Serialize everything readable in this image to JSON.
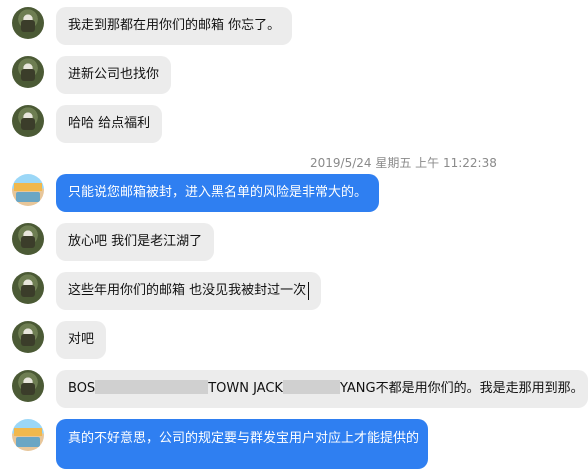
{
  "messages": [
    {
      "id": "m1",
      "sender": "user",
      "text": "我走到那都在用你们的邮箱  你忘了。"
    },
    {
      "id": "m2",
      "sender": "user",
      "text": "进新公司也找你"
    },
    {
      "id": "m3",
      "sender": "user",
      "text": "哈哈  给点福利"
    },
    {
      "id": "m4",
      "sender": "service",
      "text": "只能说您邮箱被封，进入黑名单的风险是非常大的。"
    },
    {
      "id": "m5",
      "sender": "user",
      "text": "放心吧  我们是老江湖了"
    },
    {
      "id": "m6",
      "sender": "user",
      "text": "这些年用你们的邮箱 也没见我被封过一次"
    },
    {
      "id": "m7",
      "sender": "user",
      "text": "对吧"
    },
    {
      "id": "m8",
      "sender": "user",
      "segments": {
        "a": "BOS",
        "b": "TOWN  JACK",
        "c": "YANG不都是用你们的。我是走那用到那。"
      }
    },
    {
      "id": "m9",
      "sender": "service",
      "text": "真的不好意思，公司的规定要与群发宝用户对应上才能提供的"
    }
  ],
  "timestamp": "2019/5/24 星期五 上午 11:22:38",
  "colors": {
    "incoming_bubble": "#ececec",
    "outgoing_bubble": "#2f7ff1",
    "timestamp_text": "#8a8a8a"
  },
  "icons": {
    "user_avatar": "avatar-user-icon",
    "service_avatar": "avatar-service-icon"
  }
}
